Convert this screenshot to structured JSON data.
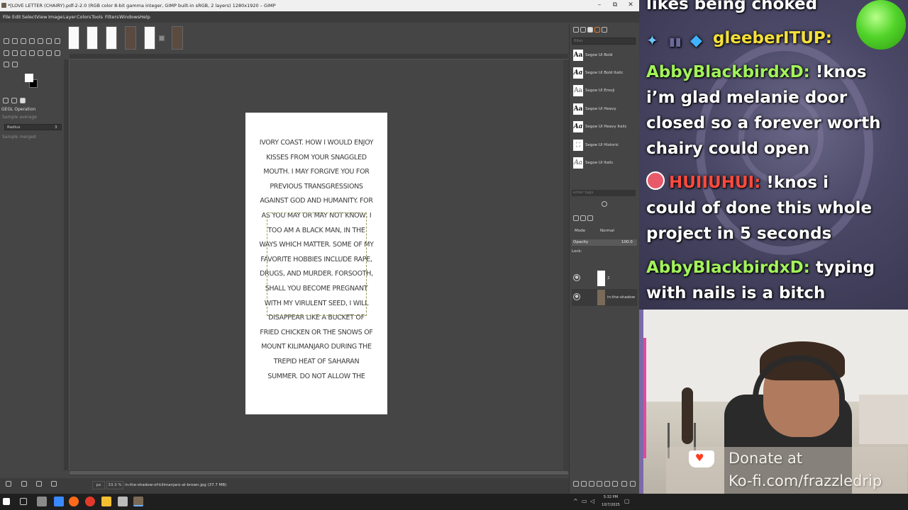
{
  "window": {
    "title": "*[LOVE LETTER (CHAIRY).pdf-2-2.0 (RGB color 8-bit gamma integer, GIMP built-in sRGB, 2 layers) 1280x1920 – GIMP",
    "minimize": "–",
    "maximize": "⧉",
    "close": "✕"
  },
  "menu": [
    "File",
    "Edit",
    "Select",
    "View",
    "Image",
    "Layer",
    "Colors",
    "Tools",
    "Filters",
    "Windows",
    "Help"
  ],
  "tool_options": {
    "title": "GEGL Operation",
    "sample_average": "Sample average",
    "radius_label": "Radius",
    "radius_value": "3",
    "sample_merged": "Sample merged"
  },
  "document": {
    "lines": [
      "IVORY COAST. HOW I WOULD ENJOY",
      "KISSES FROM YOUR SNAGGLED",
      "MOUTH. I MAY FORGIVE YOU FOR",
      "PREVIOUS TRANSGRESSIONS",
      "AGAINST GOD AND HUMANITY. FOR",
      "AS YOU MAY OR MAY NOT KNOW, I",
      "TOO AM A BLACK MAN, IN THE",
      "WAYS WHICH MATTER. SOME OF MY",
      "FAVORITE HOBBIES INCLUDE RAPE,",
      "DRUGS, AND MURDER. FORSOOTH,",
      "SHALL YOU BECOME PREGNANT",
      "WITH MY VIRULENT SEED, I WILL",
      "DISAPPEAR LIKE A BUCKET OF",
      "FRIED CHICKEN OR THE SNOWS OF",
      "MOUNT KILIMANJARO DURING THE",
      "TREPID HEAT OF SAHARAN",
      "SUMMER. DO NOT ALLOW THE"
    ]
  },
  "statusbar": {
    "unit": "px",
    "zoom": "33.3 %",
    "filename": "in-the-shadow-of-kilimanjaro-al-brown.jpg (37.7 MB)"
  },
  "fonts_panel": {
    "filter_placeholder": "filter",
    "tag_placeholder": "enter tags",
    "items": [
      {
        "glyph": "Aa",
        "name": "Segoe UI Bold"
      },
      {
        "glyph": "Aa",
        "name": "Segoe UI Bold Italic"
      },
      {
        "glyph": "Aa",
        "name": "Segoe UI Emoji"
      },
      {
        "glyph": "Aa",
        "name": "Segoe UI Heavy"
      },
      {
        "glyph": "Aa",
        "name": "Segoe UI Heavy Italic"
      },
      {
        "glyph": "⛶",
        "name": "Segoe UI Historic"
      },
      {
        "glyph": "Aa",
        "name": "Segoe UI Italic"
      }
    ]
  },
  "layers_panel": {
    "mode_label": "Mode",
    "mode_value": "Normal",
    "opacity_label": "Opacity",
    "opacity_value": "100.0",
    "lock_label": "Lock:",
    "layers": [
      {
        "name": "2"
      },
      {
        "name": "in-the-shadow"
      }
    ]
  },
  "chat": {
    "top_fragment": "likes being choked",
    "messages": [
      {
        "user": "gleeberITUP:",
        "text": ""
      },
      {
        "user": "AbbyBlackbirdxD:",
        "text": "!knos"
      },
      {
        "user": "",
        "text": "i’m glad melanie door"
      },
      {
        "user": "",
        "text": "closed so a forever worth"
      },
      {
        "user": "",
        "text": "chairy could open"
      },
      {
        "user": "HUIIUHUI:",
        "text": "!knos i"
      },
      {
        "user": "",
        "text": "could of done this whole"
      },
      {
        "user": "",
        "text": "project in 5 seconds"
      },
      {
        "user": "AbbyBlackbirdxD:",
        "text": "typing"
      },
      {
        "user": "",
        "text": "with nails is a bitch"
      }
    ]
  },
  "donate": {
    "line1": "Donate at",
    "line2": "Ko-fi.com/frazzledrip"
  },
  "taskbar": {
    "time": "5:32 PM",
    "date": "10/7/2025"
  }
}
